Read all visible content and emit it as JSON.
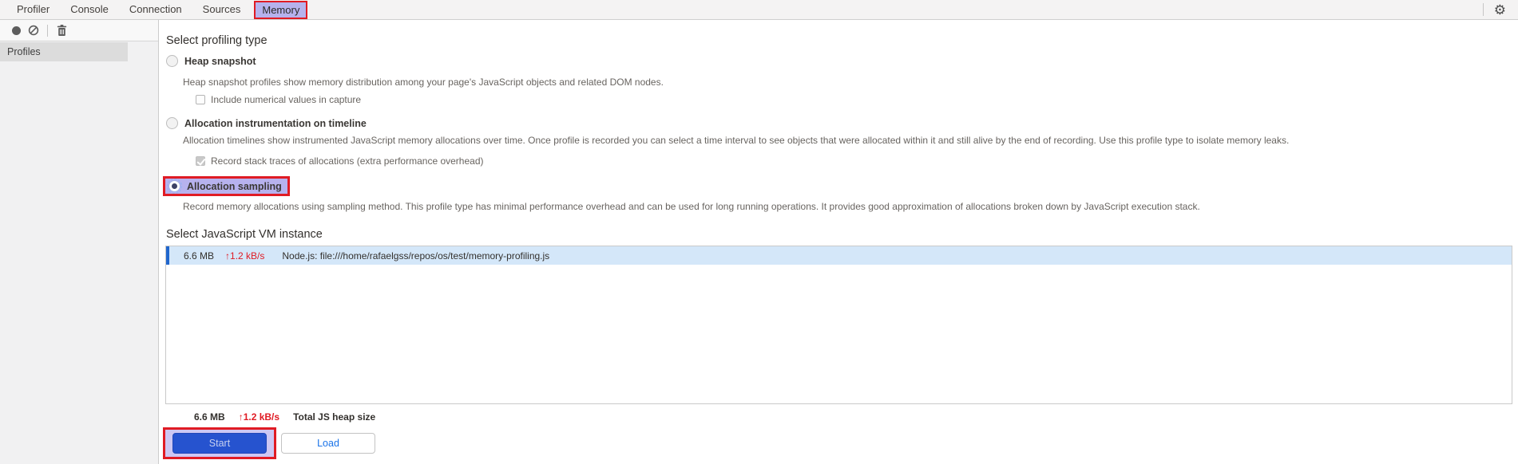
{
  "tabs": {
    "items": [
      "Profiler",
      "Console",
      "Connection",
      "Sources",
      "Memory"
    ],
    "active": "Memory"
  },
  "top_right": {
    "gear_glyph": "⚙"
  },
  "toolbar": {
    "icons": [
      "record-icon",
      "block-icon",
      "delete-icon"
    ]
  },
  "sidebar": {
    "header": "Profiles"
  },
  "main": {
    "profiling_type": {
      "heading": "Select profiling type",
      "options": [
        {
          "label": "Heap snapshot",
          "selected": false,
          "description": "Heap snapshot profiles show memory distribution among your page's JavaScript objects and related DOM nodes.",
          "checkbox": {
            "label": "Include numerical values in capture",
            "checked": false
          }
        },
        {
          "label": "Allocation instrumentation on timeline",
          "selected": false,
          "description": "Allocation timelines show instrumented JavaScript memory allocations over time. Once profile is recorded you can select a time interval to see objects that were allocated within it and still alive by the end of recording. Use this profile type to isolate memory leaks.",
          "checkbox": {
            "label": "Record stack traces of allocations (extra performance overhead)",
            "checked": true
          }
        },
        {
          "label": "Allocation sampling",
          "selected": true,
          "highlighted": true,
          "description": "Record memory allocations using sampling method. This profile type has minimal performance overhead and can be used for long running operations. It provides good approximation of allocations broken down by JavaScript execution stack."
        }
      ]
    },
    "vm_instance": {
      "heading": "Select JavaScript VM instance",
      "rows": [
        {
          "size": "6.6 MB",
          "rate": "↑1.2 kB/s",
          "name": "Node.js: file:///home/rafaelgss/repos/os/test/memory-profiling.js",
          "selected": true
        }
      ],
      "summary": {
        "size": "6.6 MB",
        "rate": "↑1.2 kB/s",
        "label": "Total JS heap size"
      }
    },
    "actions": {
      "start": "Start",
      "load": "Load"
    }
  },
  "colors": {
    "annotation_red": "#e01b24",
    "highlight_lavender": "#b6b2ed",
    "selected_row_bg": "#d4e7f9",
    "selected_row_accent": "#2066cd",
    "rate_red": "#e01b24",
    "start_button_blue": "#2653cf",
    "load_text_blue": "#1a73e8"
  }
}
